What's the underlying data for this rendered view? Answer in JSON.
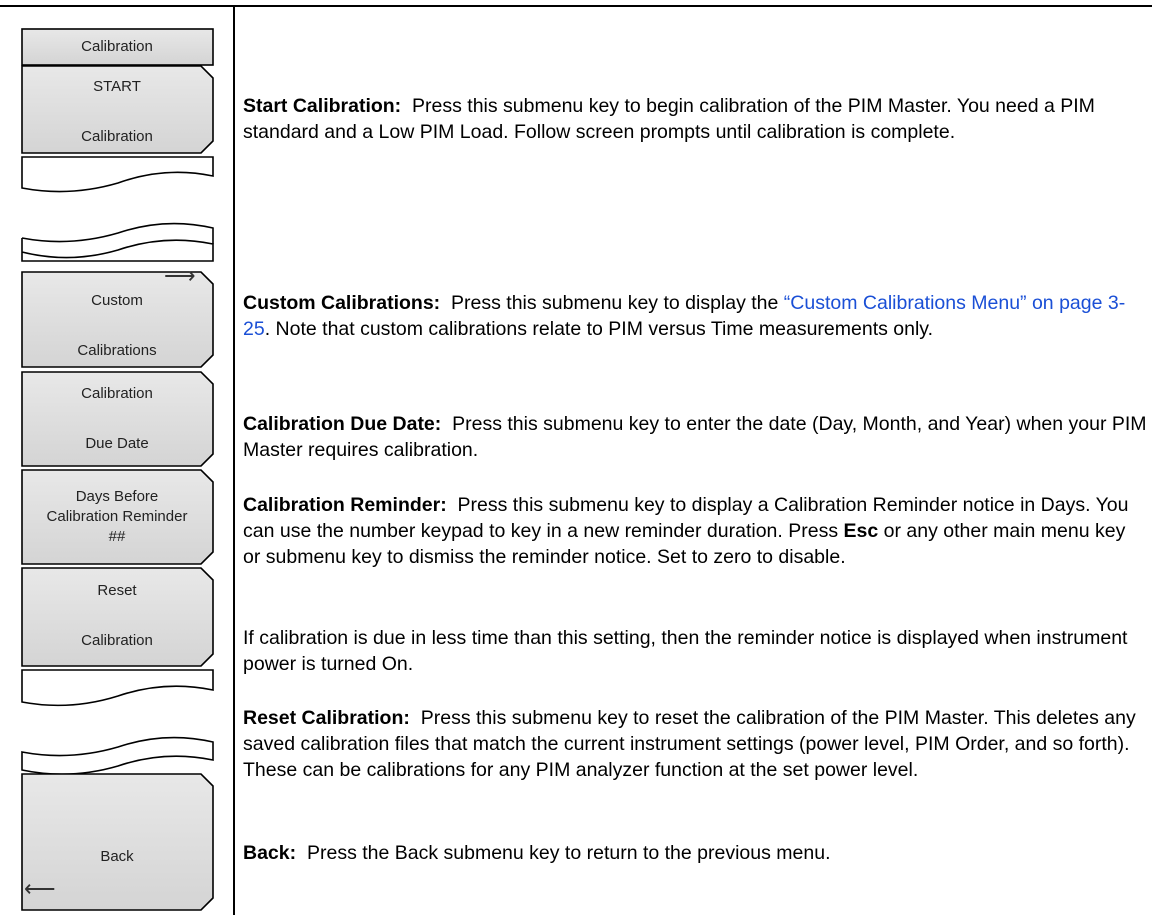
{
  "menu": {
    "title": "Calibration",
    "keys": [
      {
        "line1": "START",
        "line2": "Calibration"
      },
      {
        "line1": "Custom",
        "line2": "Calibrations",
        "has_submenu_arrow": true
      },
      {
        "line1": "Calibration",
        "line2": "Due Date"
      },
      {
        "line1": "Days Before",
        "line2": "Calibration Reminder",
        "line3": "##"
      },
      {
        "line1": "Reset",
        "line2": "Calibration"
      },
      {
        "line1": "Back",
        "has_back_arrow": true
      }
    ],
    "arrow_right_glyph": "⟶",
    "arrow_left_glyph": "⟵"
  },
  "entries": {
    "start": {
      "term": "Start Calibration:",
      "text": "Press this submenu key to begin calibration of the PIM Master. You need a PIM standard and a Low PIM Load. Follow screen prompts until calibration is complete."
    },
    "custom": {
      "term": "Custom Calibrations:",
      "text_before": "Press this submenu key to display the",
      "link": "“Custom Calibrations Menu” on page 3-25",
      "text_after": ". Note that custom calibrations relate to PIM versus Time measurements only."
    },
    "due_date": {
      "term": "Calibration Due Date:",
      "text": "Press this submenu key to enter the date (Day, Month, and Year) when your PIM Master requires calibration."
    },
    "reminder": {
      "term": "Calibration Reminder:",
      "text_before": "Press this submenu key to display a Calibration Reminder notice in Days. You can use the number keypad to key in a new reminder duration. Press",
      "key_name": "Esc",
      "text_after": "or any other main menu key or submenu key to dismiss the reminder notice. Set to zero to disable."
    },
    "reminder_note": {
      "text": "If calibration is due in less time than this setting, then the reminder notice is displayed when instrument power is turned On."
    },
    "reset": {
      "term": "Reset Calibration:",
      "text": "Press this submenu key to reset the calibration of the PIM Master. This deletes any saved calibration files that match the current instrument settings (power level, PIM Order, and so forth). These can be calibrations for any PIM analyzer function at the set power level."
    },
    "back": {
      "term": "Back:",
      "text": "Press the Back submenu key to return to the previous menu."
    }
  }
}
